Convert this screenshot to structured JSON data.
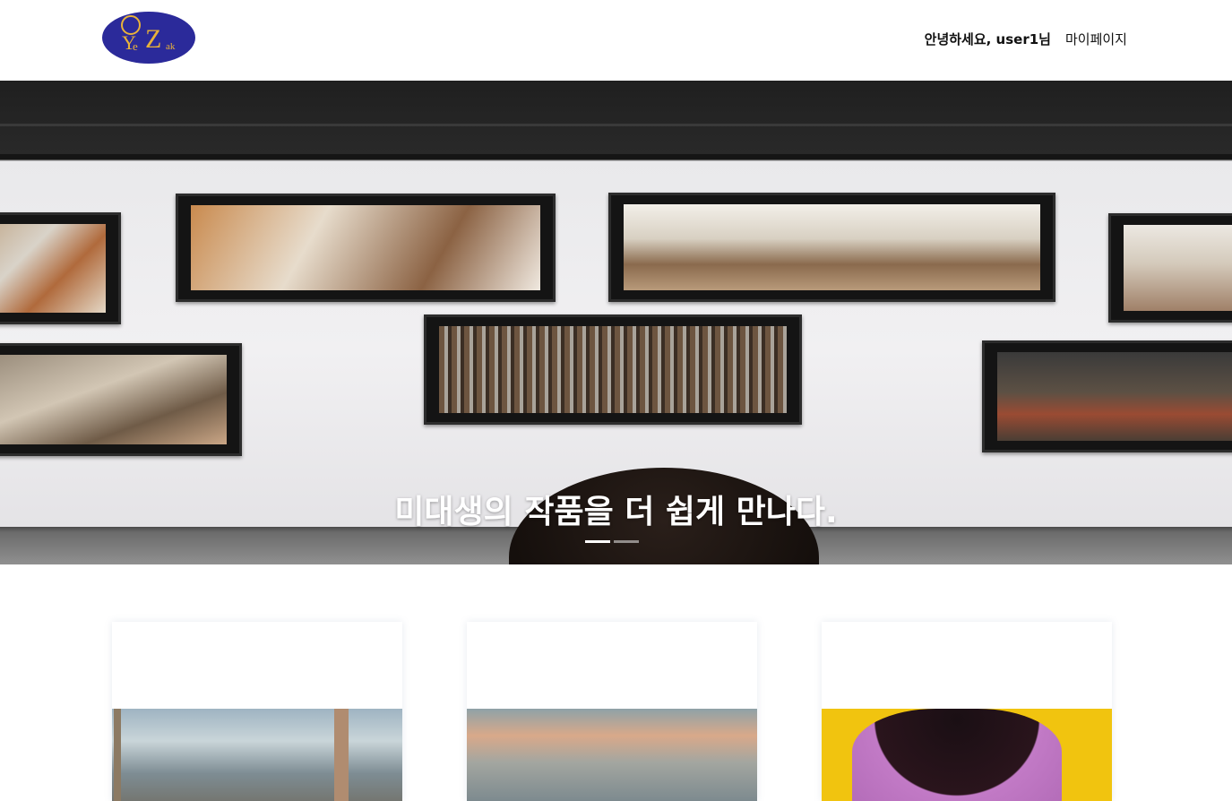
{
  "header": {
    "logo": {
      "main": "Z",
      "y": "Y",
      "e": "e",
      "ak": "ak"
    },
    "greeting": "안녕하세요, user1님",
    "mypage": "마이페이지"
  },
  "hero": {
    "caption": "미대생의 작품을 더 쉽게 만나다.",
    "slides": {
      "count": 2,
      "active": 1
    }
  },
  "cards": [
    {
      "thumb": "artwork-thumbnail"
    },
    {
      "thumb": "artwork-thumbnail"
    },
    {
      "thumb": "artwork-thumbnail"
    }
  ],
  "colors": {
    "logo_bg": "#2b2a9a",
    "logo_text": "#e8b23a",
    "card3_bg": "#f1c40f"
  }
}
